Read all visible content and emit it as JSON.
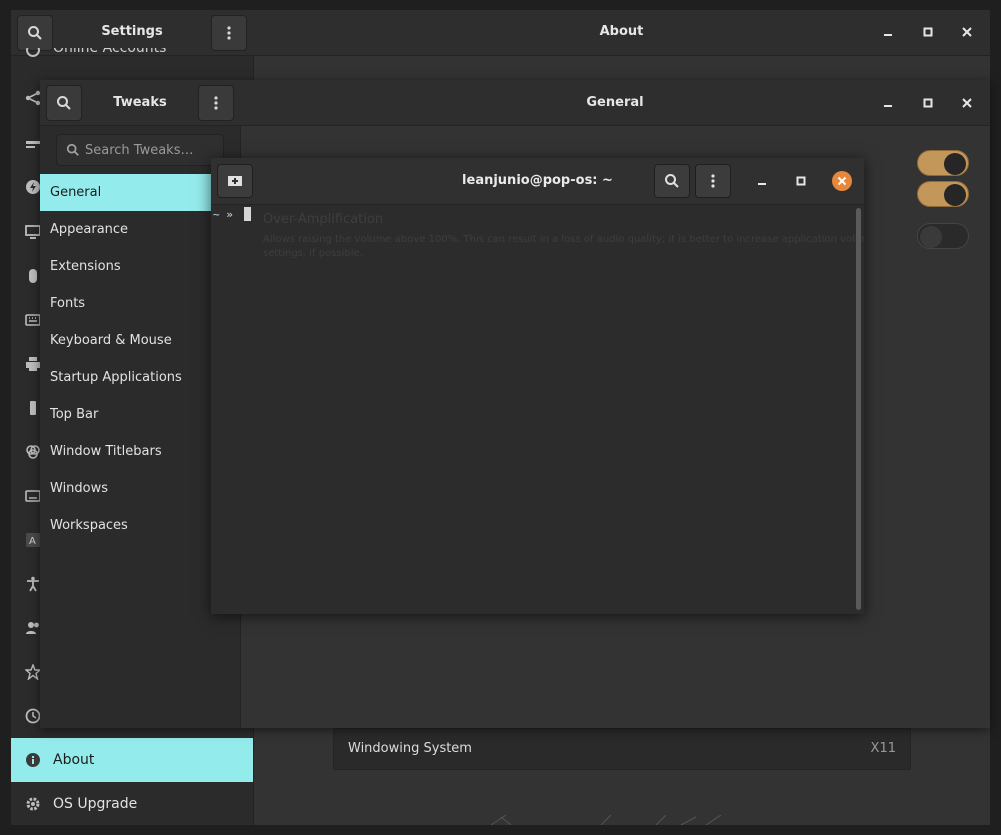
{
  "settings": {
    "title": "Settings",
    "panel_title": "About",
    "top_partial_item": "Online Accounts",
    "sidebar_icons": [
      "share-icon",
      "displays-icon",
      "power-icon",
      "screen-icon",
      "mouse-icon",
      "keyboard-icon",
      "printer-icon",
      "removable-media-icon",
      "color-icon",
      "region-language-icon",
      "accessibility-icon",
      "users-icon",
      "default-apps-icon",
      "date-time-icon"
    ],
    "bottom_items": [
      {
        "label": "About",
        "icon": "info-icon"
      },
      {
        "label": "OS Upgrade",
        "icon": "gear-icon"
      }
    ],
    "about_row": {
      "label": "Windowing System",
      "value": "X11"
    }
  },
  "tweaks": {
    "title": "Tweaks",
    "panel_title": "General",
    "search_placeholder": "Search Tweaks…",
    "items": [
      {
        "label": "General"
      },
      {
        "label": "Appearance"
      },
      {
        "label": "Extensions"
      },
      {
        "label": "Fonts"
      },
      {
        "label": "Keyboard & Mouse"
      },
      {
        "label": "Startup Applications"
      },
      {
        "label": "Top Bar"
      },
      {
        "label": "Window Titlebars"
      },
      {
        "label": "Windows"
      },
      {
        "label": "Workspaces"
      }
    ],
    "toggles": [
      true,
      true,
      false
    ],
    "over_amplification": {
      "title": "Over-Amplification",
      "description": "Allows raising the volume above 100%. This can result in a loss of audio quality; it is better to increase application volume settings, if possible."
    }
  },
  "terminal": {
    "title": "leanjunio@pop-os: ~",
    "prompt": "~ »"
  },
  "colors": {
    "accent": "#94ebeb",
    "toggle_on": "#c3965a",
    "close_button": "#e8873b"
  }
}
